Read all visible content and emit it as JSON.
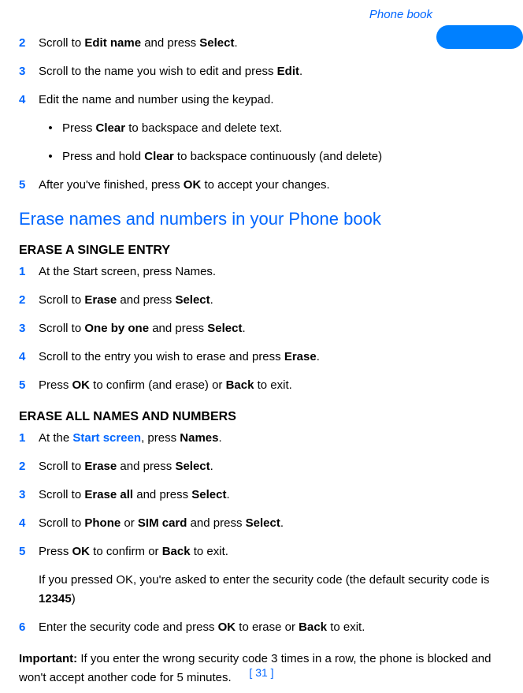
{
  "header": {
    "title": "Phone book"
  },
  "topSteps": {
    "step2": {
      "num": "2",
      "pre": "Scroll to ",
      "bold1": "Edit name",
      "mid": " and press ",
      "bold2": "Select",
      "post": "."
    },
    "step3": {
      "num": "3",
      "pre": "Scroll to the name you wish to edit and press ",
      "bold1": "Edit",
      "post": "."
    },
    "step4": {
      "num": "4",
      "text": "Edit the name and number using the keypad."
    },
    "bullet1": {
      "pre": "Press ",
      "bold1": "Clear",
      "post": " to backspace and delete text."
    },
    "bullet2": {
      "pre": "Press and hold ",
      "bold1": "Clear",
      "post": " to backspace continuously (and delete)"
    },
    "step5": {
      "num": "5",
      "pre": "After you've finished, press ",
      "bold1": "OK",
      "post": " to accept your changes."
    }
  },
  "sectionHeading": "Erase names and numbers in your Phone book",
  "eraseSingle": {
    "heading": "ERASE A SINGLE ENTRY",
    "step1": {
      "num": "1",
      "text": "At the Start screen, press Names."
    },
    "step2": {
      "num": "2",
      "pre": "Scroll to ",
      "bold1": "Erase",
      "mid": " and press ",
      "bold2": "Select",
      "post": "."
    },
    "step3": {
      "num": "3",
      "pre": "Scroll to ",
      "bold1": "One by one",
      "mid": " and press ",
      "bold2": "Select",
      "post": "."
    },
    "step4": {
      "num": "4",
      "pre": "Scroll to the entry you wish to erase and press ",
      "bold1": "Erase",
      "post": "."
    },
    "step5": {
      "num": "5",
      "pre": "Press ",
      "bold1": "OK",
      "mid": " to confirm (and erase) or ",
      "bold2": "Back",
      "post": " to exit."
    }
  },
  "eraseAll": {
    "heading": "ERASE ALL NAMES AND NUMBERS",
    "step1": {
      "num": "1",
      "pre": "At the ",
      "link": "Start screen",
      "mid": ", press ",
      "bold1": "Names",
      "post": "."
    },
    "step2": {
      "num": "2",
      "pre": "Scroll to ",
      "bold1": "Erase",
      "mid": " and press ",
      "bold2": "Select",
      "post": "."
    },
    "step3": {
      "num": "3",
      "pre": "Scroll to ",
      "bold1": "Erase all",
      "mid": " and press ",
      "bold2": "Select",
      "post": "."
    },
    "step4": {
      "num": "4",
      "pre": "Scroll to ",
      "bold1": "Phone",
      "mid": " or ",
      "bold2": "SIM card",
      "mid2": " and press ",
      "bold3": "Select",
      "post": "."
    },
    "step5": {
      "num": "5",
      "pre": "Press ",
      "bold1": "OK",
      "mid": " to confirm or ",
      "bold2": "Back",
      "post": " to exit."
    },
    "note": {
      "pre": "If you pressed OK, you're asked to enter the security code (the default security code is ",
      "bold1": "12345",
      "post": ")"
    },
    "step6": {
      "num": "6",
      "pre": "Enter the security code and press ",
      "bold1": "OK",
      "mid": " to erase or ",
      "bold2": "Back",
      "post": " to exit."
    }
  },
  "important": {
    "label": "Important:",
    "text": " If you enter the wrong security code 3 times in a row, the phone is blocked and won't accept another code for 5 minutes."
  },
  "pageNumber": "[ 31 ]",
  "bulletChar": "•"
}
